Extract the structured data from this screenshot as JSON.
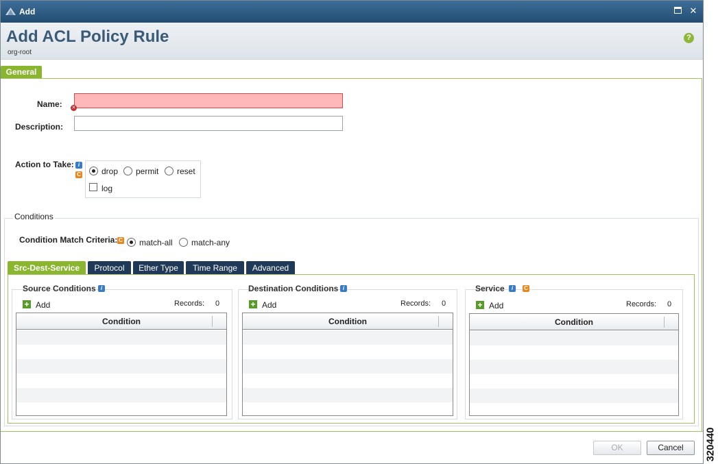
{
  "window": {
    "title": "Add",
    "maximize_icon": "maximize-icon",
    "close_icon": "close-icon"
  },
  "header": {
    "title": "Add ACL Policy Rule",
    "org": "org-root",
    "help_icon": "help-icon"
  },
  "tabs": {
    "general": "General"
  },
  "form": {
    "name_label": "Name:",
    "name_value": "",
    "description_label": "Description:",
    "description_value": "",
    "action_label": "Action to Take:",
    "actions": [
      "drop",
      "permit",
      "reset"
    ],
    "selected_action": "drop",
    "log_label": "log",
    "log_checked": false
  },
  "conditions": {
    "title": "Conditions",
    "match_label": "Condition Match Criteria:",
    "match_options": [
      "match-all",
      "match-any"
    ],
    "selected_match": "match-all",
    "subtabs": [
      "Src-Dest-Service",
      "Protocol",
      "Ether Type",
      "Time Range",
      "Advanced"
    ],
    "active_subtab": "Src-Dest-Service",
    "groups": [
      {
        "title": "Source Conditions",
        "add_label": "Add",
        "records_label": "Records:",
        "records_count": "0",
        "column": "Condition"
      },
      {
        "title": "Destination Conditions",
        "add_label": "Add",
        "records_label": "Records:",
        "records_count": "0",
        "column": "Condition"
      },
      {
        "title": "Service",
        "add_label": "Add",
        "records_label": "Records:",
        "records_count": "0",
        "column": "Condition"
      }
    ]
  },
  "footer": {
    "ok_label": "OK",
    "cancel_label": "Cancel"
  },
  "side_label": "320440",
  "colors": {
    "accent": "#8ab52f",
    "titlebar": "#2b5a82",
    "error": "#ffb8b8",
    "dark_tab": "#1e3a58"
  }
}
